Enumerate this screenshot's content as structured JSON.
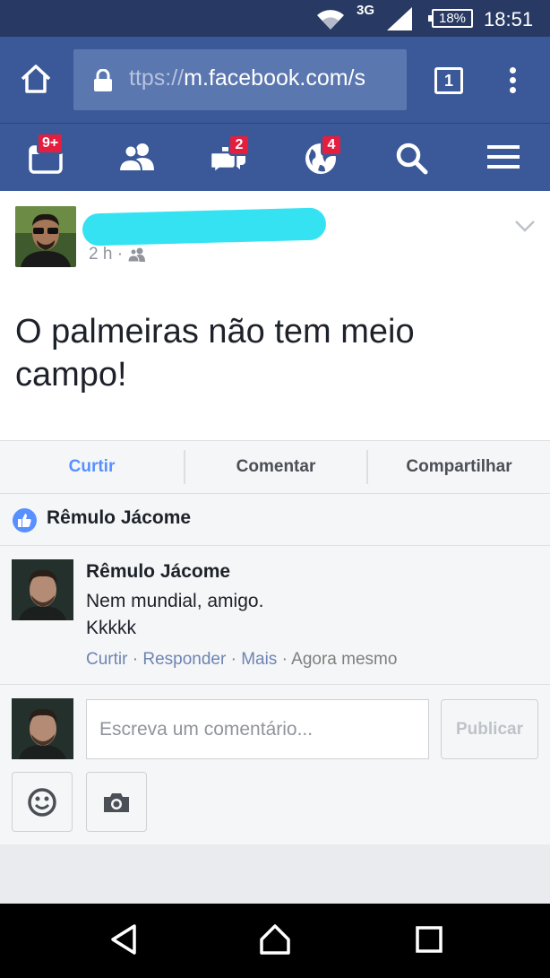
{
  "status_bar": {
    "network": "3G",
    "battery": "18%",
    "time": "18:51"
  },
  "browser": {
    "url_prefix": "ttps://",
    "url_host": "m.facebook.com/s",
    "tab_count": "1"
  },
  "nav": {
    "badges": {
      "notifications_feed": "9+",
      "messages": "2",
      "notifications": "4"
    },
    "icons": [
      "feed-icon",
      "friends-icon",
      "messages-icon",
      "globe-icon",
      "search-icon",
      "menu-icon"
    ]
  },
  "post": {
    "time": "2 h",
    "meta_sep": "·",
    "text": "O palmeiras não tem meio campo!"
  },
  "actions": {
    "like": "Curtir",
    "comment": "Comentar",
    "share": "Compartilhar"
  },
  "likes": {
    "liker": "Rêmulo Jácome"
  },
  "comment": {
    "author": "Rêmulo Jácome",
    "line1": "Nem mundial, amigo.",
    "line2": "Kkkkk",
    "action_like": "Curtir",
    "action_reply": "Responder",
    "action_more": "Mais",
    "timestamp": "Agora mesmo",
    "sep": "·"
  },
  "composer": {
    "placeholder": "Escreva um comentário...",
    "publish": "Publicar"
  },
  "colors": {
    "facebook_blue": "#3b5998",
    "status_bar": "#283a63",
    "like_blue": "#5890ff",
    "badge_red": "#e41e3f",
    "redaction_cyan": "#35e2f2"
  }
}
